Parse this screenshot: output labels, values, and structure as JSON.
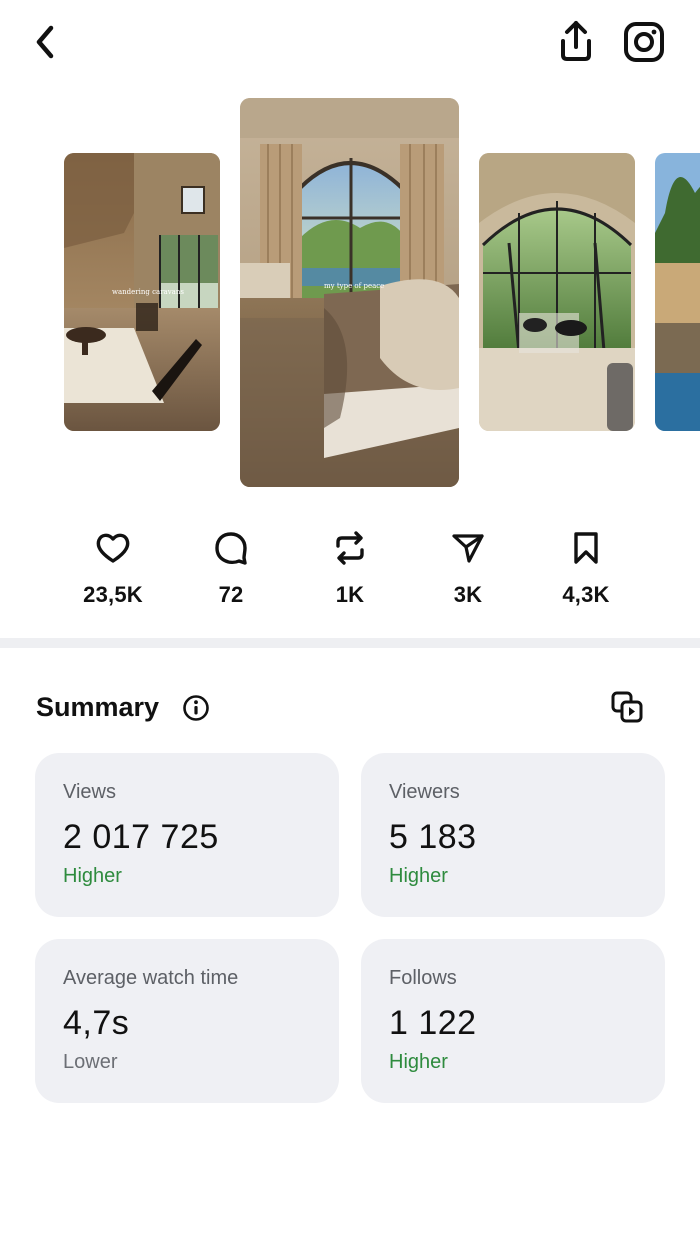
{
  "carousel": {
    "captions": [
      "wandering caravans",
      "my type of peace"
    ]
  },
  "stats": {
    "likes": "23,5K",
    "comments": "72",
    "reposts": "1K",
    "shares": "3K",
    "saves": "4,3K"
  },
  "summary": {
    "title": "Summary",
    "cards": [
      {
        "label": "Views",
        "value": "2 017 725",
        "trend": "Higher"
      },
      {
        "label": "Viewers",
        "value": "5 183",
        "trend": "Higher"
      },
      {
        "label": "Average watch time",
        "value": "4,7s",
        "trend": "Lower"
      },
      {
        "label": "Follows",
        "value": "1 122",
        "trend": "Higher"
      }
    ]
  },
  "colors": {
    "higher": "#2e8b3e",
    "lower": "#6c6f75",
    "card_bg": "#eff0f4"
  },
  "icons": [
    "back-icon",
    "share-icon",
    "instagram-icon",
    "heart-icon",
    "comment-icon",
    "repost-icon",
    "send-icon",
    "bookmark-icon",
    "info-icon",
    "copy-icon"
  ]
}
